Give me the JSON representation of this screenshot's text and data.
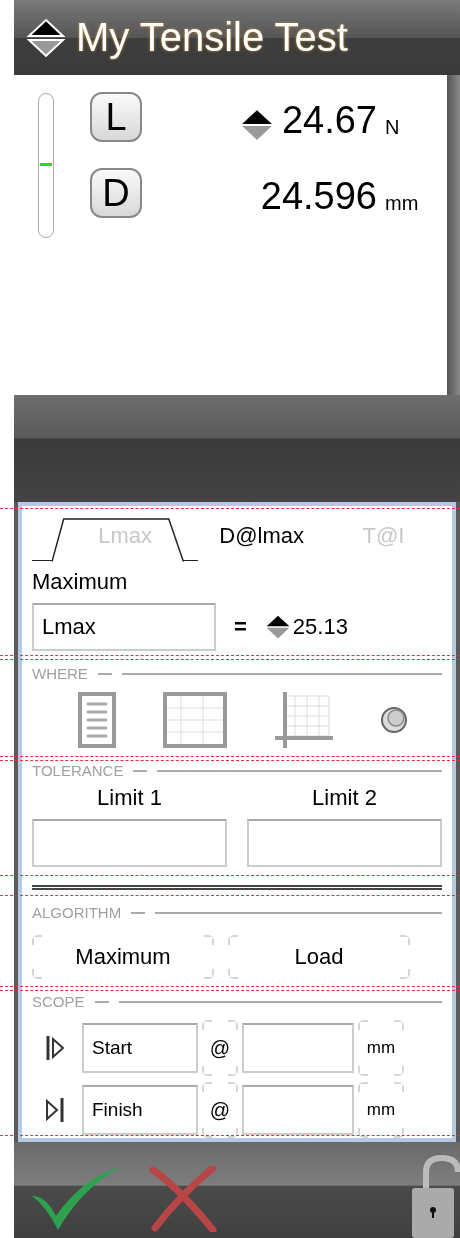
{
  "title": "My Tensile Test",
  "meter": {
    "level": 0.5
  },
  "channels": [
    {
      "key": "L",
      "value": "24.67",
      "unit": "N",
      "spinner": true
    },
    {
      "key": "D",
      "value": "24.596",
      "unit": "mm",
      "spinner": false
    }
  ],
  "tabs": [
    {
      "label": "Lmax",
      "selected": true,
      "disabled": true
    },
    {
      "label": "D@lmax",
      "selected": false,
      "disabled": false
    },
    {
      "label": "T@I",
      "selected": false,
      "disabled": true
    }
  ],
  "result": {
    "label": "Maximum",
    "name": "Lmax",
    "equals": "=",
    "value": "25.13"
  },
  "where": {
    "heading": "WHERE",
    "options": [
      {
        "kind": "list"
      },
      {
        "kind": "table"
      },
      {
        "kind": "chart"
      },
      {
        "kind": "marker"
      }
    ]
  },
  "tolerance": {
    "heading": "TOLERANCE",
    "limits": [
      {
        "label": "Limit 1"
      },
      {
        "label": "Limit 2"
      }
    ]
  },
  "algorithm": {
    "heading": "ALGORITHM",
    "buttons": [
      "Maximum",
      "Load"
    ]
  },
  "scope": {
    "heading": "SCOPE",
    "rows": [
      {
        "kind": "start",
        "label": "Start",
        "at": "@",
        "unit": "mm"
      },
      {
        "kind": "finish",
        "label": "Finish",
        "at": "@",
        "unit": "mm"
      }
    ]
  },
  "footer": {
    "locked": false
  }
}
